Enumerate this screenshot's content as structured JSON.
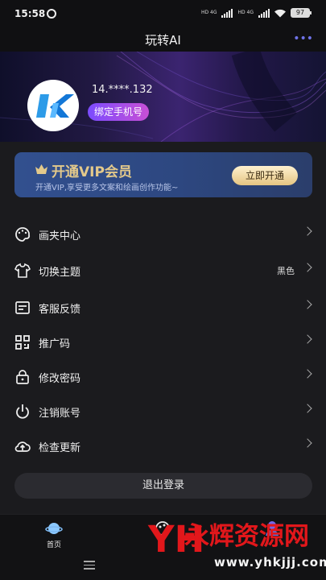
{
  "status_bar": {
    "time": "15:58",
    "network_1": "HD 4G",
    "network_2": "HD 4G",
    "battery": "97"
  },
  "header": {
    "title": "玩转AI",
    "more_icon": "more-dots-icon"
  },
  "profile": {
    "user_id": "14.****.132",
    "bind_button": "绑定手机号"
  },
  "vip": {
    "title": "开通VIP会员",
    "description": "开通VIP,享受更多文案和绘画创作功能~",
    "button": "立即开通"
  },
  "menu": [
    {
      "label": "画夹中心",
      "icon": "palette-icon"
    },
    {
      "label": "切换主题",
      "icon": "tshirt-icon",
      "value": "黑色"
    },
    {
      "label": "客服反馈",
      "icon": "feedback-icon"
    },
    {
      "label": "推广码",
      "icon": "qr-code-icon"
    },
    {
      "label": "修改密码",
      "icon": "lock-icon"
    },
    {
      "label": "注销账号",
      "icon": "power-icon"
    },
    {
      "label": "检查更新",
      "icon": "cloud-upload-icon"
    }
  ],
  "logout": "退出登录",
  "tabbar": {
    "home_label": "首页"
  },
  "watermark": {
    "logo_text": "YH",
    "brand": "永辉资源网",
    "url": "www.yhkjjj.com"
  },
  "colors": {
    "background": "#1b1b1e",
    "accent": "#6f73e8",
    "vip_gold": "#e3c98b",
    "watermark_red": "#e2171b"
  }
}
